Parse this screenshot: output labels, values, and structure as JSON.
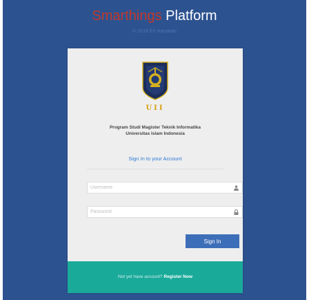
{
  "header": {
    "brand_accent": "Smarthings",
    "brand_main": "Platform",
    "copyright": "© 2018 Eri Haryanto"
  },
  "card": {
    "logo_text": "UII",
    "program_line1": "Program Studi Magister Teknik Informatika",
    "program_line2": "Universitas Islam Indonesia",
    "signin_title": "Sign In to your Account",
    "username_placeholder": "Username",
    "password_placeholder": "Password",
    "username_icon": "user-icon",
    "password_icon": "lock-icon",
    "signin_button": "Sign In"
  },
  "footer": {
    "prompt": "Not yet have account?",
    "register_link": "Register Now"
  },
  "colors": {
    "background": "#2d5290",
    "accent_red": "#c0392b",
    "card": "#eeeeee",
    "link_blue": "#2f7ad1",
    "button": "#3d6eb8",
    "footer": "#1aaa9a"
  }
}
